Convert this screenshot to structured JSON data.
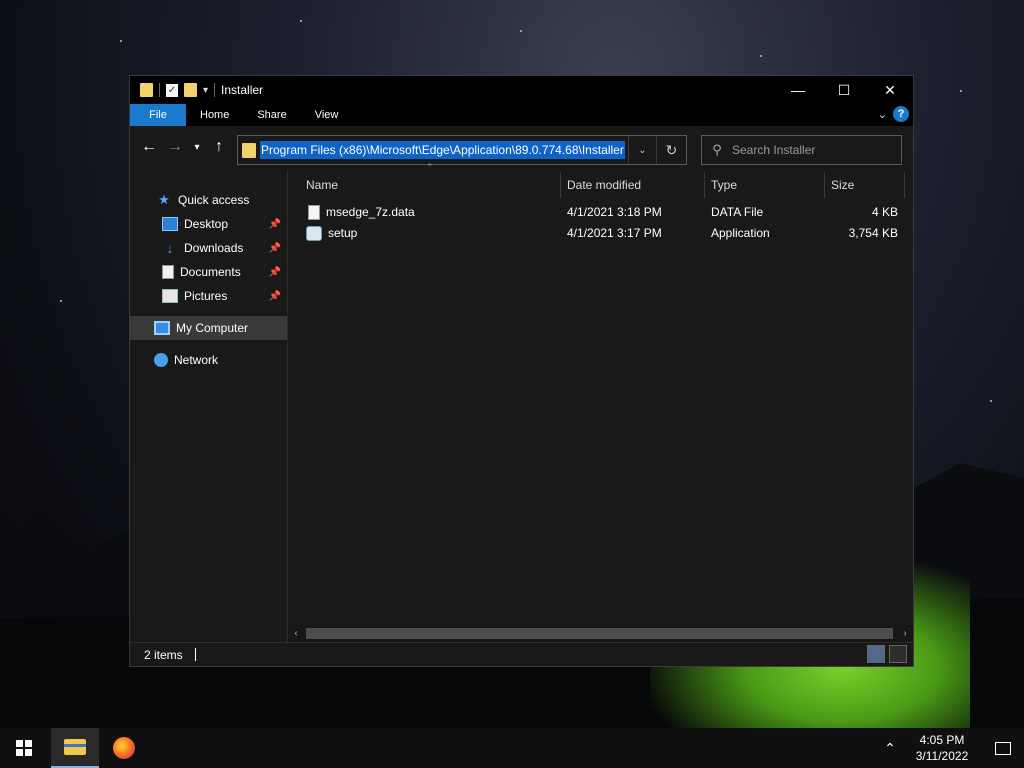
{
  "window": {
    "title": "Installer",
    "controls": {
      "minimize": "—",
      "maximize": "☐",
      "close": "✕"
    }
  },
  "ribbon": {
    "tabs": [
      "File",
      "Home",
      "Share",
      "View"
    ],
    "help": "?"
  },
  "address": {
    "path": "Program Files (x86)\\Microsoft\\Edge\\Application\\89.0.774.68\\Installer",
    "search_placeholder": "Search Installer"
  },
  "nav_pane": {
    "items": [
      {
        "label": "Quick access"
      },
      {
        "label": "Desktop"
      },
      {
        "label": "Downloads"
      },
      {
        "label": "Documents"
      },
      {
        "label": "Pictures"
      },
      {
        "label": "My Computer"
      },
      {
        "label": "Network"
      }
    ]
  },
  "columns": [
    "Name",
    "Date modified",
    "Type",
    "Size"
  ],
  "files": [
    {
      "name": "msedge_7z.data",
      "date": "4/1/2021 3:18 PM",
      "type": "DATA File",
      "size": "4 KB"
    },
    {
      "name": "setup",
      "date": "4/1/2021 3:17 PM",
      "type": "Application",
      "size": "3,754 KB"
    }
  ],
  "status": {
    "count": "2 items"
  },
  "taskbar": {
    "time": "4:05 PM",
    "date": "3/11/2022"
  },
  "colors": {
    "accent": "#1979ca",
    "selection": "#0e63c9",
    "window_bg": "#191919",
    "titlebar_bg": "#000000"
  }
}
